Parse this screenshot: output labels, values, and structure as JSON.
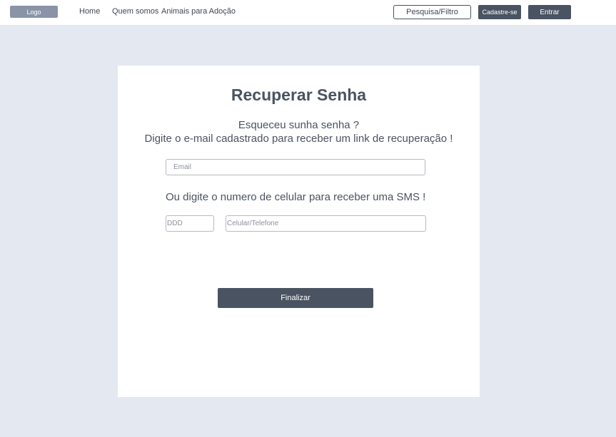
{
  "header": {
    "logo": "Logo",
    "nav": {
      "home": "Home",
      "about": "Quem somos",
      "animals": "Animais para Adoção"
    },
    "search_button": "Pesquisa/Filtro",
    "signup_button": "Cadastre-se",
    "login_button": "Entrar"
  },
  "form": {
    "title": "Recuperar Senha",
    "subtitle": "Esqueceu sunha senha ?",
    "instructions": "Digite o e-mail cadastrado para receber um link de recuperação !",
    "email_placeholder": "Email",
    "sms_instructions": "Ou digite o numero de celular para receber uma SMS !",
    "ddd_placeholder": "DDD",
    "phone_placeholder": "Celular/Telefone",
    "submit_button": "Finalizar"
  },
  "colors": {
    "background": "#e4e8f0",
    "primary": "#4a5361",
    "logo": "#8a94a8"
  }
}
